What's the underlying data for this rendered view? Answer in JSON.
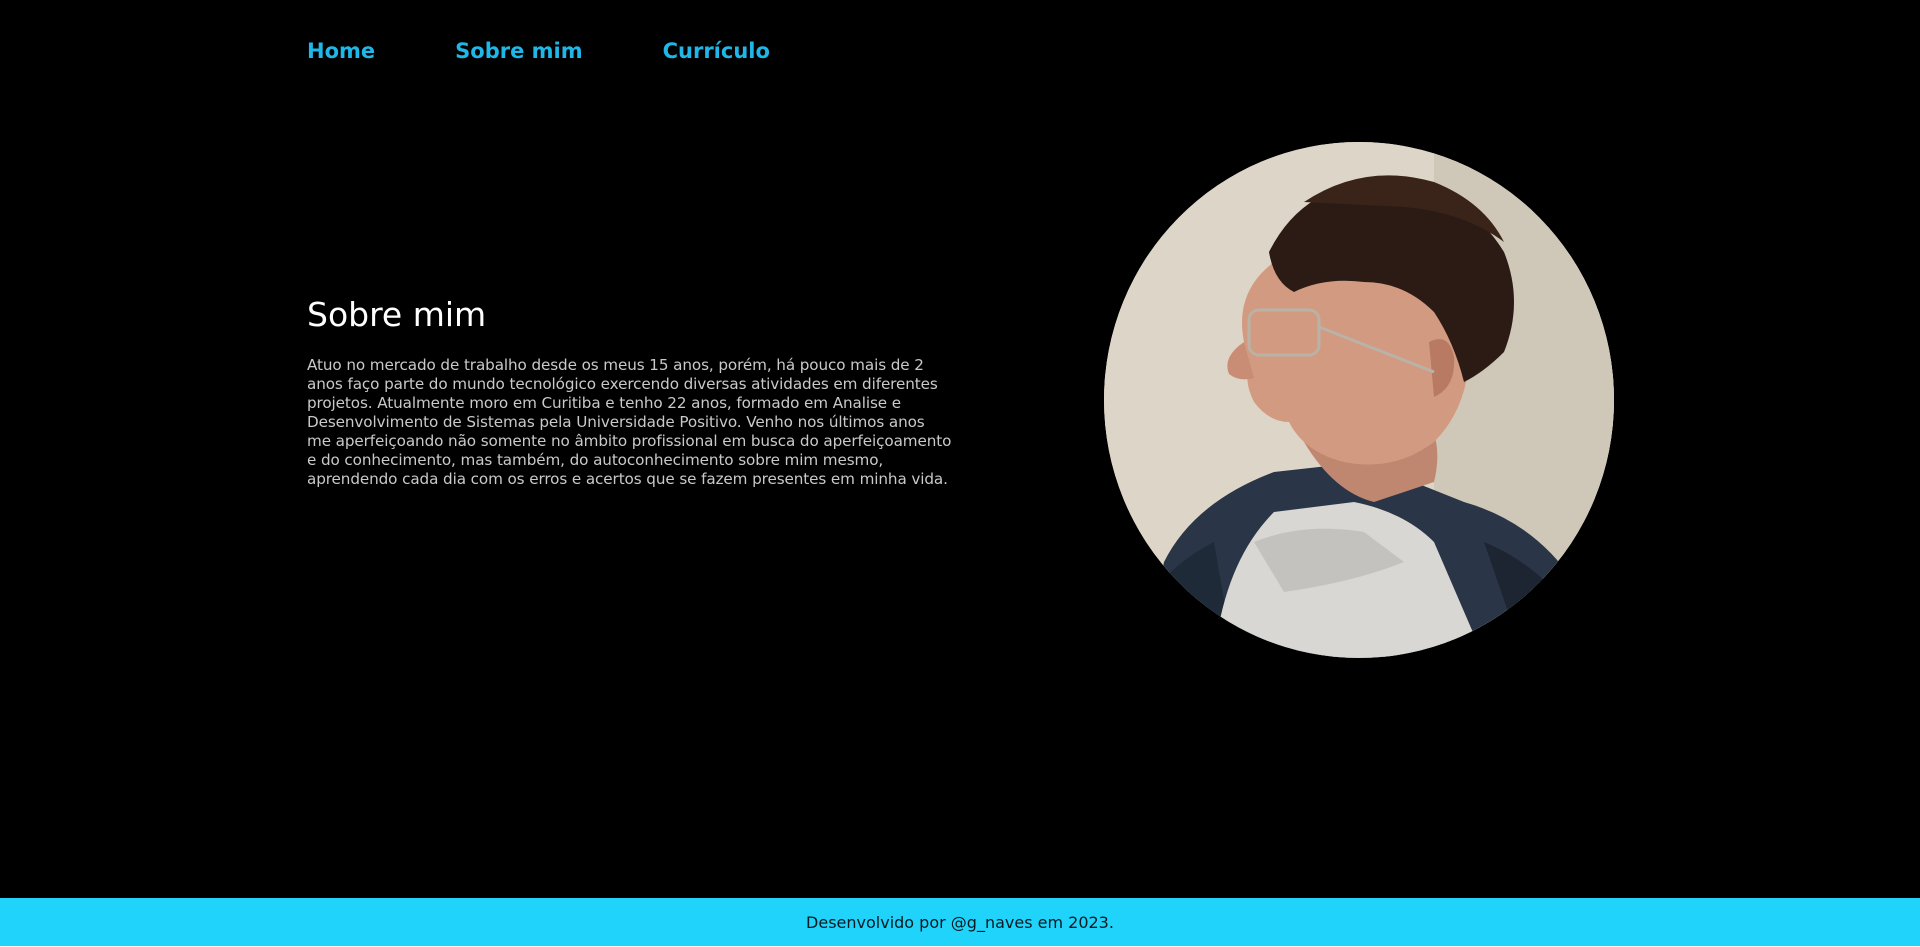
{
  "nav": {
    "items": [
      {
        "label": "Home"
      },
      {
        "label": "Sobre mim"
      },
      {
        "label": "Currículo"
      }
    ]
  },
  "about": {
    "title": "Sobre mim",
    "body": "Atuo no mercado de trabalho desde os meus 15 anos, porém, há pouco mais de 2 anos faço parte do mundo tecnológico exercendo diversas atividades em diferentes projetos. Atualmente moro em Curitiba e tenho 22 anos, formado em Analise e Desenvolvimento de Sistemas pela Universidade Positivo. Venho nos últimos anos me aperfeiçoando não somente no âmbito profissional em busca do aperfeiçoamento e do conhecimento, mas também, do autoconhecimento sobre mim mesmo, aprendendo cada dia com os erros e acertos que se fazem presentes em minha vida."
  },
  "photo": {
    "icon": "profile-photo"
  },
  "footer": {
    "text": "Desenvolvido por @g_naves em 2023."
  },
  "colors": {
    "background": "#000000",
    "accent": "#1fb6e8",
    "footer_bg": "#1fd3fb",
    "heading": "#ffffff",
    "body_text": "#c9c9c9"
  }
}
